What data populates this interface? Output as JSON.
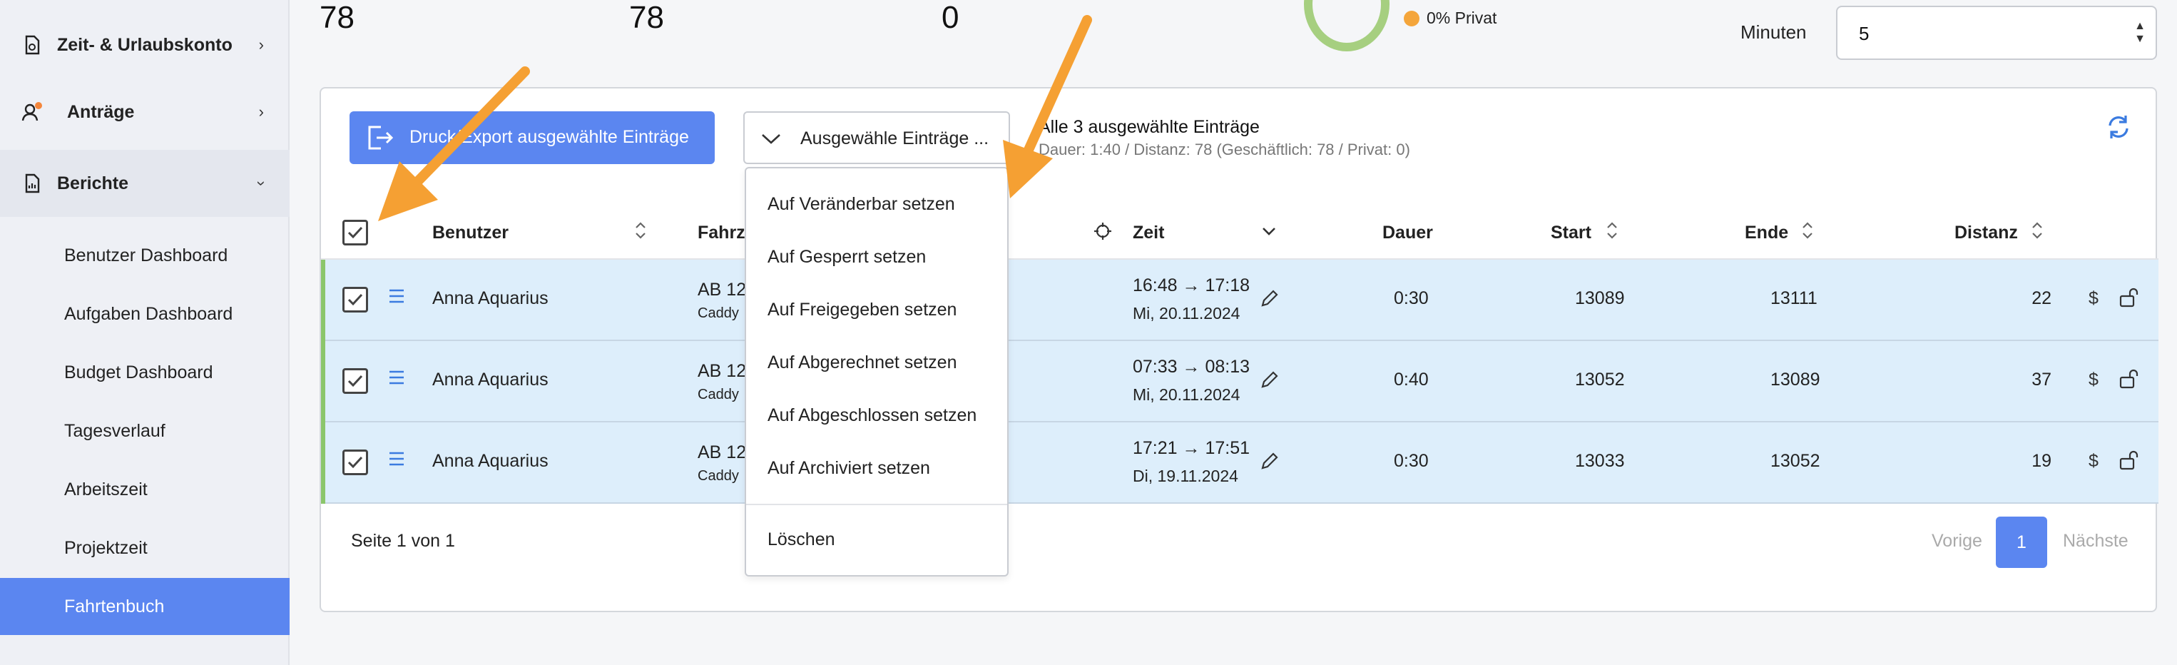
{
  "sidebar": {
    "items": [
      {
        "label": "Zeit- & Urlaubskonto",
        "icon": "document-clock-icon"
      },
      {
        "label": "Anträge",
        "icon": "user-notification-icon"
      },
      {
        "label": "Berichte",
        "icon": "report-icon"
      }
    ],
    "subitems": [
      "Benutzer Dashboard",
      "Aufgaben Dashboard",
      "Budget Dashboard",
      "Tagesverlauf",
      "Arbeitszeit",
      "Projektzeit",
      "Fahrtenbuch"
    ],
    "active_subitem": "Fahrtenbuch"
  },
  "stats": {
    "values": [
      "78",
      "78",
      "0"
    ],
    "privat_label": "0% Privat",
    "minutes_label": "Minuten",
    "minutes_value": "5"
  },
  "toolbar": {
    "export_label": "Druck/Export ausgewählte Einträge",
    "bulk_label": "Ausgewähle Einträge ...",
    "selection_title": "Alle 3 ausgewählte Einträge",
    "selection_summary": "Dauer: 1:40 / Distanz: 78 (Geschäftlich: 78 / Privat: 0)"
  },
  "dropdown": {
    "items": [
      "Auf Veränderbar setzen",
      "Auf Gesperrt setzen",
      "Auf Freigegeben setzen",
      "Auf Abgerechnet setzen",
      "Auf Abgeschlossen setzen",
      "Auf Archiviert setzen"
    ],
    "delete_label": "Löschen"
  },
  "table": {
    "columns": {
      "user": "Benutzer",
      "vehicle": "Fahrz",
      "time": "Zeit",
      "duration": "Dauer",
      "start": "Start",
      "end": "Ende",
      "distance": "Distanz"
    },
    "rows": [
      {
        "user": "Anna Aquarius",
        "vehicle": "AB 12",
        "vehicle_sub": "Caddy",
        "time": "16:48 → 17:18",
        "date": "Mi, 20.11.2024",
        "duration": "0:30",
        "start": "13089",
        "end": "13111",
        "distance": "22"
      },
      {
        "user": "Anna Aquarius",
        "vehicle": "AB 12",
        "vehicle_sub": "Caddy",
        "time": "07:33 → 08:13",
        "date": "Mi, 20.11.2024",
        "duration": "0:40",
        "start": "13052",
        "end": "13089",
        "distance": "37"
      },
      {
        "user": "Anna Aquarius",
        "vehicle": "AB 12",
        "vehicle_sub": "Caddy",
        "time": "17:21 → 17:51",
        "date": "Di, 19.11.2024",
        "duration": "0:30",
        "start": "13033",
        "end": "13052",
        "distance": "19"
      }
    ]
  },
  "pagination": {
    "page_text": "Seite 1 von 1",
    "prev": "Vorige",
    "current": "1",
    "next": "Nächste"
  },
  "colors": {
    "accent": "#5b86f0",
    "row_bg": "#ddeefb",
    "annotation_arrow": "#f5a033",
    "donut": "#a6cf80"
  }
}
